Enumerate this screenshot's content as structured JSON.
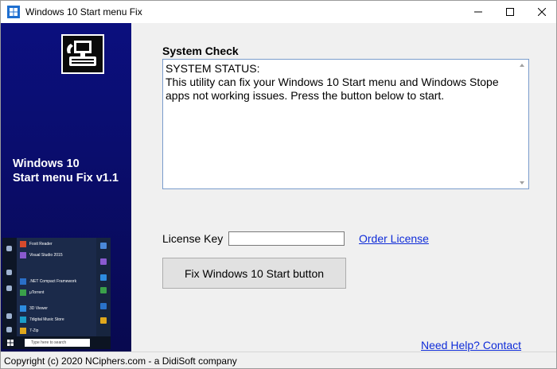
{
  "window": {
    "title": "Windows 10 Start menu Fix",
    "controls": [
      "minimize-icon",
      "maximize-icon",
      "close-icon"
    ]
  },
  "sidebar": {
    "brand_line1": "Windows 10",
    "brand_line2": "Start menu Fix v1.1",
    "preview": {
      "items": [
        "Foxit Reader",
        "Visual Studio 2015",
        ".NET Compact Framework",
        "µTorrent",
        "3D Viewer",
        "7digital Music Store",
        "7-Zip"
      ],
      "search_placeholder": "Type here to search"
    }
  },
  "main": {
    "system_check_label": "System Check",
    "status_title": "SYSTEM STATUS:",
    "status_text": "This utility can fix your Windows 10 Start menu and Windows Stope apps not working issues. Press the button below to start.",
    "license_label": "License Key",
    "license_value": "",
    "order_link": "Order License",
    "fix_button": "Fix Windows 10 Start button",
    "help_link": "Need Help? Contact Support"
  },
  "statusbar": {
    "copyright": "Copyright (c) 2020 NCiphers.com - a DidiSoft company"
  },
  "colors": {
    "sidebar": "#0b0f7e",
    "link": "#0f2cd8",
    "status_border": "#7a9ccc",
    "button": "#e1e1e1"
  }
}
